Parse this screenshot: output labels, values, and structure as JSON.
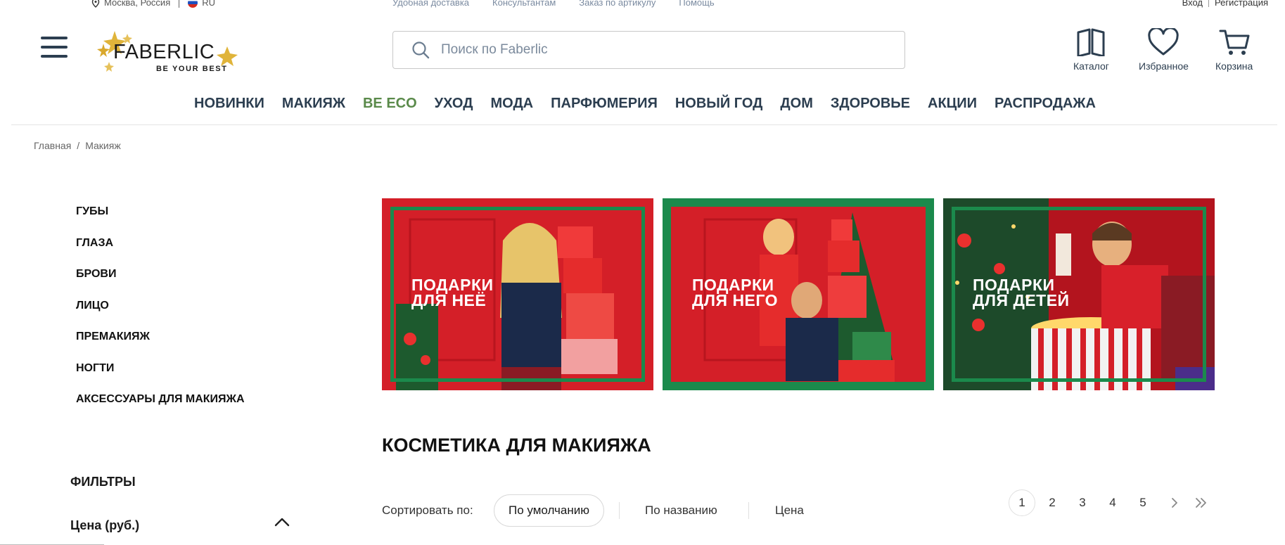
{
  "topbar": {
    "location": "Москва, Россия",
    "lang": "RU",
    "links": [
      "Удобная доставка",
      "Консультантам",
      "Заказ по артикулу",
      "Помощь"
    ],
    "login": "Вход",
    "register": "Регистрация"
  },
  "logo": {
    "name": "FABERLIC",
    "tagline": "BE YOUR BEST"
  },
  "search": {
    "placeholder": "Поиск по Faberlic"
  },
  "header_icons": {
    "catalog": "Каталог",
    "favorites": "Избранное",
    "cart": "Корзина"
  },
  "nav": [
    "НОВИНКИ",
    "МАКИЯЖ",
    "BE ECO",
    "УХОД",
    "МОДА",
    "ПАРФЮМЕРИЯ",
    "НОВЫЙ ГОД",
    "ДОМ",
    "ЗДОРОВЬЕ",
    "АКЦИИ",
    "РАСПРОДАЖА"
  ],
  "breadcrumb": {
    "home": "Главная",
    "sep": "/",
    "current": "Макияж"
  },
  "sidebar": {
    "categories": [
      "ГУБЫ",
      "ГЛАЗА",
      "БРОВИ",
      "ЛИЦО",
      "ПРЕМАКИЯЖ",
      "НОГТИ",
      "АКСЕССУАРЫ ДЛЯ МАКИЯЖА"
    ],
    "filters_title": "ФИЛЬТРЫ",
    "price_title": "Цена (руб.)"
  },
  "banners": [
    {
      "line1": "ПОДАРКИ",
      "line2": "ДЛЯ НЕЁ"
    },
    {
      "line1": "ПОДАРКИ",
      "line2": "ДЛЯ НЕГО"
    },
    {
      "line1": "ПОДАРКИ",
      "line2": "ДЛЯ ДЕТЕЙ"
    }
  ],
  "page_title": "КОСМЕТИКА ДЛЯ МАКИЯЖА",
  "sort": {
    "label": "Сортировать по:",
    "options": [
      "По умолчанию",
      "По названию",
      "Цена"
    ],
    "selected": "По умолчанию"
  },
  "pagination": {
    "pages": [
      "1",
      "2",
      "3",
      "4",
      "5"
    ],
    "current": "1"
  },
  "colors": {
    "brand_green": "#1b8a4c",
    "nav_text": "#2c3e50",
    "eco_green": "#5a8a4a",
    "banner_red": "#d8202a"
  }
}
